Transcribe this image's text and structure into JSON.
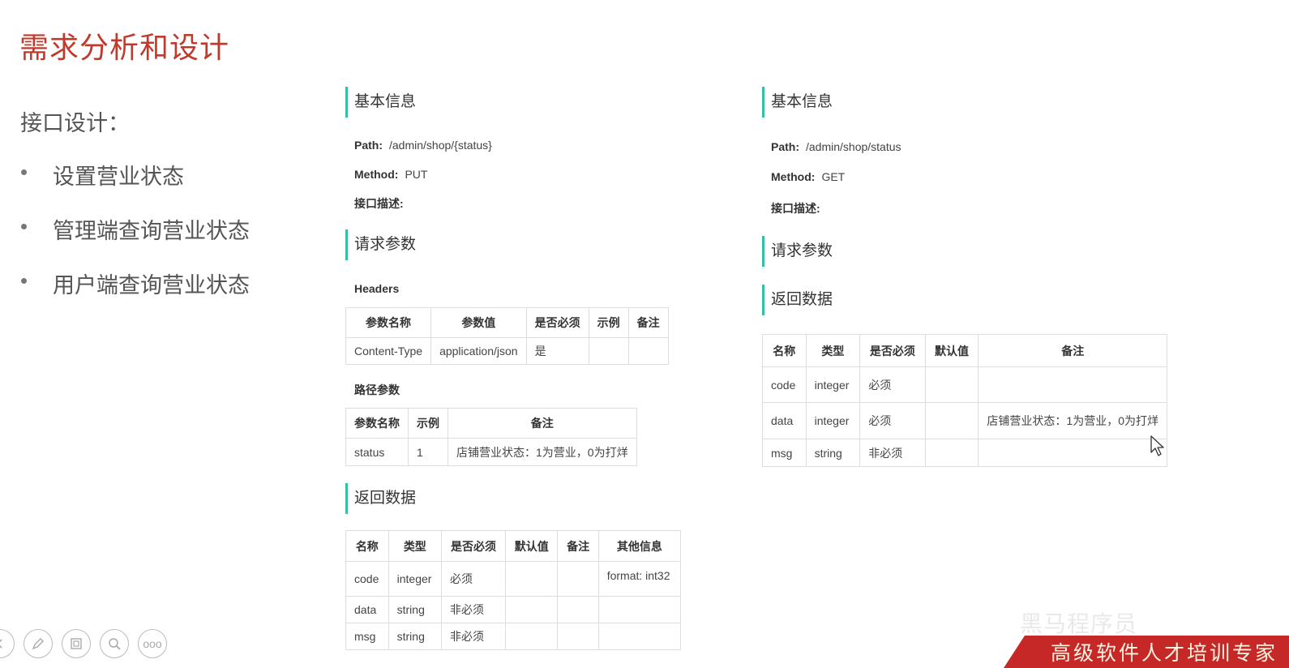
{
  "slide": {
    "title": "需求分析和设计",
    "heading": "接口设计：",
    "bullets": [
      "设置营业状态",
      "管理端查询营业状态",
      "用户端查询营业状态"
    ]
  },
  "api_put": {
    "basic_title": "基本信息",
    "path_label": "Path:",
    "path_value": "/admin/shop/{status}",
    "method_label": "Method:",
    "method_value": "PUT",
    "desc_label": "接口描述:",
    "request_title": "请求参数",
    "headers_label": "Headers",
    "headers_table": {
      "columns": [
        "参数名称",
        "参数值",
        "是否必须",
        "示例",
        "备注"
      ],
      "rows": [
        [
          "Content-Type",
          "application/json",
          "是",
          "",
          ""
        ]
      ]
    },
    "path_params_label": "路径参数",
    "path_params_table": {
      "columns": [
        "参数名称",
        "示例",
        "备注"
      ],
      "rows": [
        [
          "status",
          "1",
          "店铺营业状态：1为营业，0为打烊"
        ]
      ]
    },
    "response_title": "返回数据",
    "response_table": {
      "columns": [
        "名称",
        "类型",
        "是否必须",
        "默认值",
        "备注",
        "其他信息"
      ],
      "rows": [
        [
          "code",
          "integer",
          "必须",
          "",
          "",
          "format: int32"
        ],
        [
          "data",
          "string",
          "非必须",
          "",
          "",
          ""
        ],
        [
          "msg",
          "string",
          "非必须",
          "",
          "",
          ""
        ]
      ]
    }
  },
  "api_get": {
    "basic_title": "基本信息",
    "path_label": "Path:",
    "path_value": "/admin/shop/status",
    "method_label": "Method:",
    "method_value": "GET",
    "desc_label": "接口描述:",
    "request_title": "请求参数",
    "response_title": "返回数据",
    "response_table": {
      "columns": [
        "名称",
        "类型",
        "是否必须",
        "默认值",
        "备注"
      ],
      "rows": [
        [
          "code",
          "integer",
          "必须",
          "",
          ""
        ],
        [
          "data",
          "integer",
          "必须",
          "",
          "店铺营业状态：1为营业，0为打烊"
        ],
        [
          "msg",
          "string",
          "非必须",
          "",
          ""
        ]
      ]
    }
  },
  "toolbar": {
    "icons": [
      "prev-icon",
      "pen-icon",
      "slides-icon",
      "zoom-icon",
      "more-icon"
    ],
    "more_label": "ooo"
  },
  "watermark": "黑马程序员",
  "banner": "高级软件人才培训专家",
  "colors": {
    "title_red": "#c0392b",
    "accent_teal": "#33c2a1",
    "banner_red": "#c62828"
  }
}
